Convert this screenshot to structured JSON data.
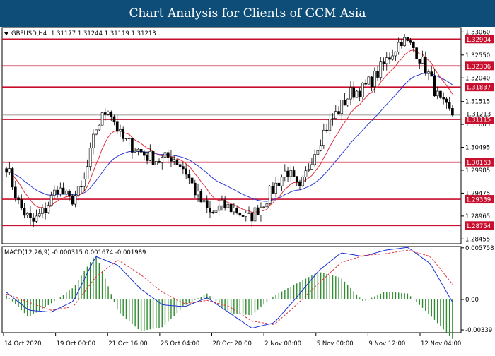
{
  "header": {
    "title": "Chart Analysis for Clients of GCM Asia"
  },
  "chart_data": [
    {
      "type": "candlestick",
      "symbol_label": "GBPUSD,H4",
      "ohlc_label": "1.31177 1.31244 1.31119 1.31213",
      "ylim": [
        1.2835,
        1.3316
      ],
      "y_ticks": [
        "1.33060",
        "1.32550",
        "1.32040",
        "1.31515",
        "1.31005",
        "1.30495",
        "1.29985",
        "1.29475",
        "1.28965",
        "1.28455"
      ],
      "x_labels": [
        "14 Oct 2020",
        "19 Oct 00:00",
        "21 Oct 16:00",
        "26 Oct 04:00",
        "28 Oct 20:00",
        "2 Nov 08:00",
        "5 Nov 00:00",
        "9 Nov 12:00",
        "12 Nov 04:00"
      ],
      "levels": [
        {
          "label": "1.32904",
          "value": 1.32904
        },
        {
          "label": "1.32306",
          "value": 1.32306
        },
        {
          "label": "1.31837",
          "value": 1.31837
        },
        {
          "label": "1.31115",
          "value": 1.31115
        },
        {
          "label": "1.30163",
          "value": 1.30163
        },
        {
          "label": "1.29339",
          "value": 1.29339
        },
        {
          "label": "1.28754",
          "value": 1.28754
        }
      ],
      "current_price": {
        "label": "1.31213",
        "value": 1.31213
      },
      "key_closes": [
        1.301,
        1.292,
        1.288,
        1.291,
        1.296,
        1.293,
        1.296,
        1.309,
        1.314,
        1.307,
        1.305,
        1.303,
        1.302,
        1.303,
        1.3,
        1.294,
        1.29,
        1.292,
        1.291,
        1.289,
        1.292,
        1.296,
        1.3,
        1.295,
        1.303,
        1.309,
        1.313,
        1.317,
        1.318,
        1.321,
        1.325,
        1.329,
        1.327,
        1.322,
        1.315,
        1.3121
      ],
      "colors": {
        "level_line": "#c8102e",
        "level_label_bg": "#c8102e",
        "ema_fast": "#e0303a",
        "ema_slow": "#2b3ad6",
        "candle": "#000000"
      }
    },
    {
      "type": "macd",
      "label": "MACD(12,26,9) -0.000315 0.001674 -0.001989",
      "y_ticks": [
        "0.005758",
        "0.00",
        "-0.00339"
      ],
      "ylim": [
        -0.0037,
        0.0059
      ],
      "macd_key": [
        0.0008,
        -0.0012,
        -0.0014,
        -0.0002,
        0.0048,
        0.0038,
        0.0012,
        -0.0006,
        -0.0008,
        0.0002,
        -0.0015,
        -0.0032,
        -0.0026,
        0.0002,
        0.0032,
        0.0052,
        0.0048,
        0.0055,
        0.0058,
        0.004,
        -0.0003
      ],
      "signal_key": [
        0.0006,
        -0.0003,
        -0.0012,
        -0.0008,
        0.0025,
        0.0044,
        0.0028,
        0.0008,
        -0.0005,
        -0.0001,
        -0.0008,
        -0.0024,
        -0.0028,
        -0.0006,
        0.0018,
        0.0041,
        0.0049,
        0.0051,
        0.0055,
        0.0048,
        0.0017
      ],
      "colors": {
        "macd": "#1a2fd6",
        "signal": "#e0303a",
        "histogram": "#2e8b2e"
      }
    }
  ]
}
